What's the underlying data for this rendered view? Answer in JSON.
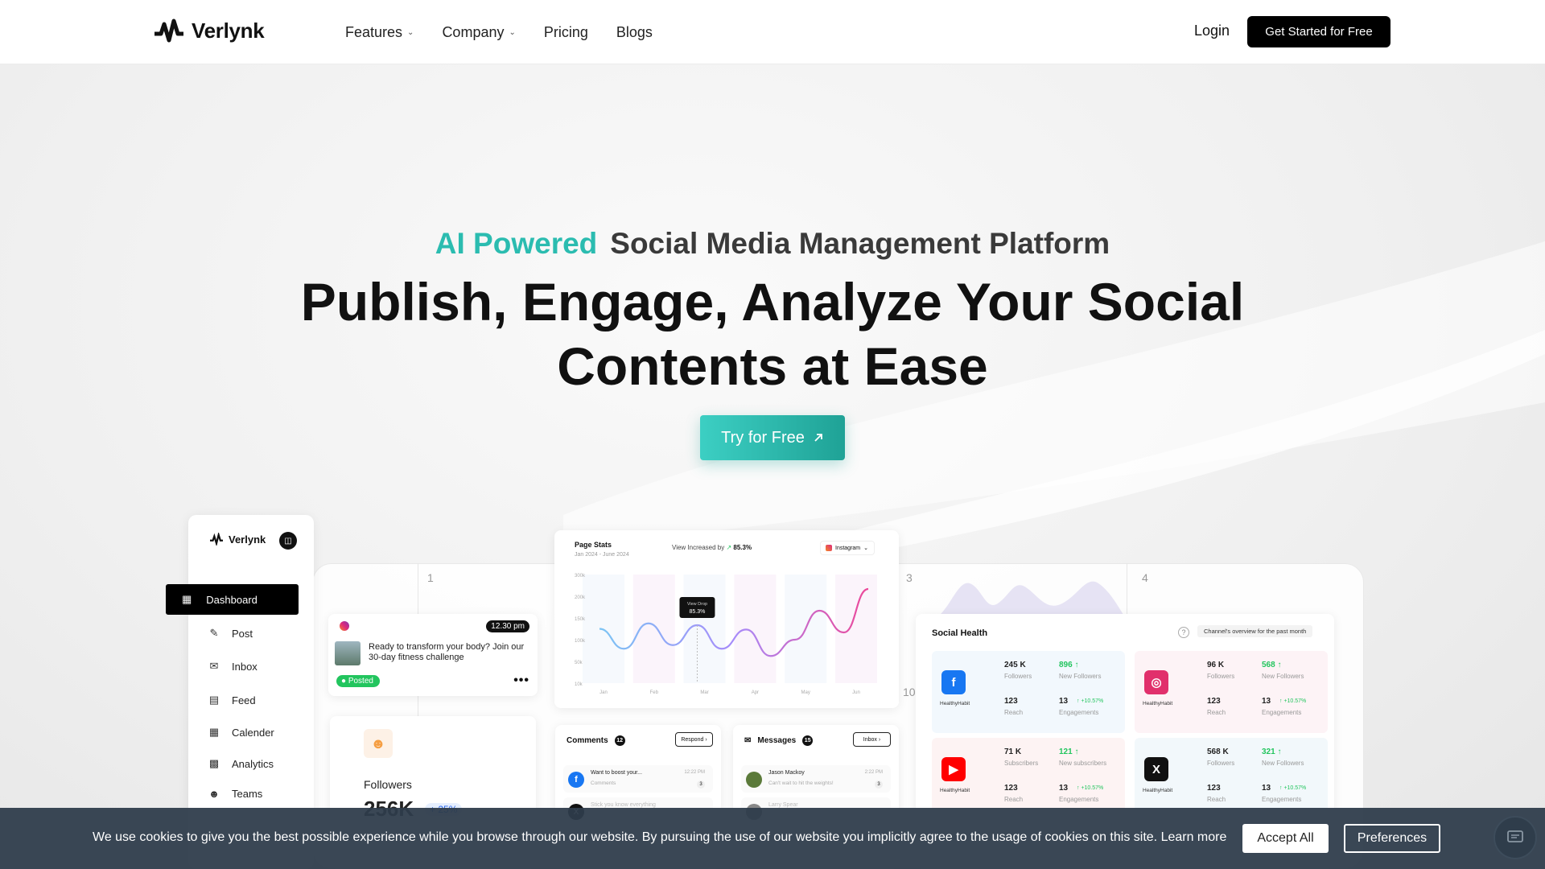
{
  "brand": {
    "name": "Verlynk"
  },
  "nav": {
    "items": [
      {
        "label": "Features",
        "has_dropdown": true
      },
      {
        "label": "Company",
        "has_dropdown": true
      },
      {
        "label": "Pricing",
        "has_dropdown": false
      },
      {
        "label": "Blogs",
        "has_dropdown": false
      }
    ],
    "login": "Login",
    "cta": "Get Started for Free"
  },
  "hero": {
    "accent": "AI Powered",
    "subtitle": "Social Media Management Platform",
    "title_line1": "Publish, Engage, Analyze Your Social",
    "title_line2": "Contents at Ease",
    "button": "Try for Free",
    "button_icon": "arrow-up-right-icon"
  },
  "dashboard": {
    "brand": "Verlynk",
    "sidebar": {
      "active": {
        "label": "Dashboard",
        "icon": "grid-icon"
      },
      "items": [
        {
          "label": "Post",
          "icon": "edit-icon"
        },
        {
          "label": "Inbox",
          "icon": "mail-icon"
        },
        {
          "label": "Feed",
          "icon": "feed-icon"
        },
        {
          "label": "Calender",
          "icon": "calendar-icon"
        },
        {
          "label": "Analytics",
          "icon": "chart-icon"
        },
        {
          "label": "Teams",
          "icon": "users-icon"
        }
      ]
    },
    "columns": [
      "1",
      "3",
      "4",
      "10"
    ],
    "post": {
      "time": "12.30 pm",
      "text": "Ready to transform your body? Join our 30-day fitness challenge",
      "status": "Posted"
    },
    "followers": {
      "label": "Followers",
      "value": "256K",
      "change": "+ 25%"
    },
    "page_stats": {
      "title": "Page Stats",
      "range": "Jan 2024 - June 2024",
      "view_label": "View Increased by",
      "view_value": "85.3%",
      "platform": "Instagram",
      "tooltip_title": "View Drop",
      "tooltip_value": "85.3%"
    },
    "comments": {
      "title": "Comments",
      "count": "12",
      "button": "Respond",
      "rows": [
        {
          "name": "Want to boost your...",
          "sub": "Comments",
          "time": "12:22 PM",
          "n": "3"
        },
        {
          "name": "Stick you know everything",
          "sub": "",
          "time": "",
          "n": ""
        }
      ]
    },
    "messages": {
      "title": "Messages",
      "count": "15",
      "button": "Inbox",
      "rows": [
        {
          "name": "Jason Mackoy",
          "sub": "Can't wait to hit the weights!",
          "time": "2:22 PM",
          "n": "3"
        },
        {
          "name": "Larry Spear",
          "sub": "",
          "time": "",
          "n": ""
        }
      ]
    },
    "social_health": {
      "title": "Social Health",
      "badge": "Channel's overview for the past month",
      "channels": [
        {
          "platform": "facebook",
          "account": "HealthyHabit",
          "color": "#1877f2",
          "bg": "#f2f8fd",
          "m1": "245 K",
          "l1": "Followers",
          "m2": "896",
          "l2": "New Followers",
          "m3": "123",
          "l3": "Reach",
          "m4": "13",
          "pct": "+10.57%",
          "l4": "Engagements"
        },
        {
          "platform": "instagram",
          "account": "HealthyHabit",
          "color": "#e1306c",
          "bg": "#fdf3f6",
          "m1": "96 K",
          "l1": "Followers",
          "m2": "568",
          "l2": "New Followers",
          "m3": "123",
          "l3": "Reach",
          "m4": "13",
          "pct": "+10.57%",
          "l4": "Engagements"
        },
        {
          "platform": "youtube",
          "account": "HealthyHabit",
          "color": "#ff0000",
          "bg": "#fdf3f3",
          "m1": "71 K",
          "l1": "Subscribers",
          "m2": "121",
          "l2": "New subscribers",
          "m3": "123",
          "l3": "Reach",
          "m4": "13",
          "pct": "+10.57%",
          "l4": "Engagements"
        },
        {
          "platform": "x",
          "account": "HealthyHabit",
          "color": "#111111",
          "bg": "#f2f8fb",
          "m1": "568 K",
          "l1": "Followers",
          "m2": "321",
          "l2": "New Followers",
          "m3": "123",
          "l3": "Reach",
          "m4": "13",
          "pct": "+10.57%",
          "l4": "Engagements"
        }
      ]
    }
  },
  "chart_data": {
    "type": "line",
    "title": "Page Stats",
    "categories": [
      "Jan",
      "Feb",
      "Mar",
      "Apr",
      "May",
      "Jun"
    ],
    "y_ticks": [
      "10k",
      "50k",
      "100k",
      "150k",
      "200k",
      "300k"
    ],
    "series": [
      {
        "values": [
          150,
          95,
          165,
          105,
          160,
          95,
          148,
          75,
          120,
          200,
          140,
          260
        ]
      }
    ]
  },
  "cookie": {
    "text": "We use cookies to give you the best possible experience while you browse through our website. By pursuing the use of our website you implicitly agree to the usage of cookies on this site.",
    "learn_more": "Learn more",
    "accept": "Accept All",
    "preferences": "Preferences"
  },
  "colors": {
    "accent": "#2bbcb0",
    "primary": "#000000"
  }
}
